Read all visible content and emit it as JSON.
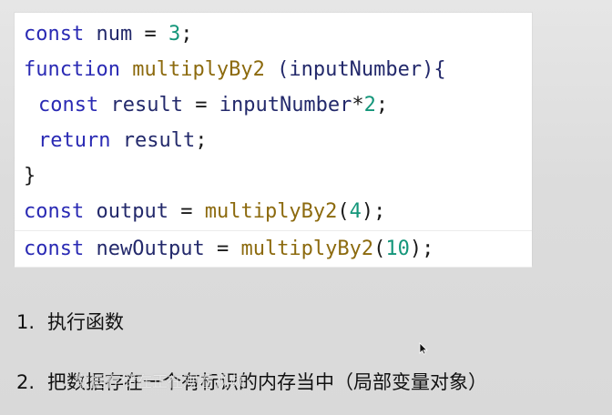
{
  "code": {
    "line1": {
      "kw": "const",
      "name": "num",
      "op": "=",
      "value": "3",
      "end": ";"
    },
    "line2": {
      "kw": "function",
      "fn": "multiplyBy2",
      "params": "(inputNumber){"
    },
    "line3": {
      "kw": "const",
      "name": "result",
      "op": "=",
      "expr_id": "inputNumber",
      "expr_op": "*",
      "value": "2",
      "end": ";"
    },
    "line4": {
      "kw": "return",
      "name": "result",
      "end": ";"
    },
    "line5": {
      "text": "}"
    },
    "line6": {
      "kw": "const",
      "name": "output",
      "op": "=",
      "fn": "multiplyBy2",
      "open": "(",
      "arg": "4",
      "close": ");"
    },
    "line7": {
      "kw": "const",
      "name": "newOutput",
      "op": "=",
      "fn": "multiplyBy2",
      "open": "(",
      "arg": "10",
      "close": ");"
    }
  },
  "notes": [
    {
      "number": "1.",
      "text": "执行函数"
    },
    {
      "number": "2.",
      "text": "把数据存在一个有标识的内存当中（局部变量对象）"
    }
  ],
  "subtitle": "数据存储在正在观看视频",
  "colors": {
    "keyword": "#2a2ab4",
    "function": "#8c6a0e",
    "identifier": "#23296b",
    "number": "#14967a"
  },
  "icons": {
    "cursor": "arrow-cursor-icon"
  }
}
